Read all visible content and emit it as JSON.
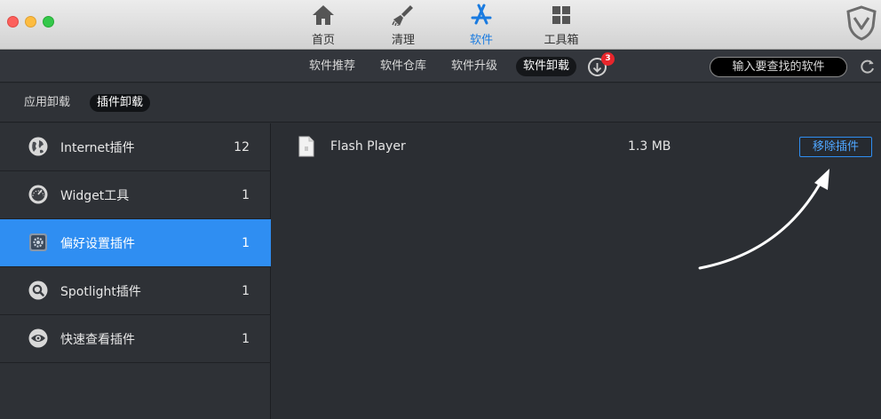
{
  "nav": {
    "tabs": [
      {
        "label": "首页",
        "icon": "home-icon"
      },
      {
        "label": "清理",
        "icon": "broom-icon"
      },
      {
        "label": "软件",
        "icon": "app-store-icon"
      },
      {
        "label": "工具箱",
        "icon": "toolbox-icon"
      }
    ],
    "active_index": 2
  },
  "toolbar": {
    "subtabs": [
      "软件推荐",
      "软件仓库",
      "软件升级",
      "软件卸载"
    ],
    "active_subtab": "软件卸载",
    "download_badge": "3",
    "search_placeholder": "输入要查找的软件"
  },
  "categories": {
    "tabs": [
      "应用卸载",
      "插件卸载"
    ],
    "active": "插件卸载"
  },
  "sidebar": {
    "items": [
      {
        "label": "Internet插件",
        "count": "12",
        "icon": "globe-icon"
      },
      {
        "label": "Widget工具",
        "count": "1",
        "icon": "dashboard-gauge-icon"
      },
      {
        "label": "偏好设置插件",
        "count": "1",
        "icon": "preferences-gear-icon"
      },
      {
        "label": "Spotlight插件",
        "count": "1",
        "icon": "magnifier-icon"
      },
      {
        "label": "快速查看插件",
        "count": "1",
        "icon": "eye-icon"
      }
    ],
    "active_index": 2
  },
  "plugins": [
    {
      "name": "Flash Player",
      "size": "1.3 MB",
      "action": "移除插件"
    }
  ],
  "colors": {
    "accent": "#2f8ef2",
    "active_nav": "#1a7be0",
    "badge": "#e8262c",
    "background": "#2b2e33"
  }
}
